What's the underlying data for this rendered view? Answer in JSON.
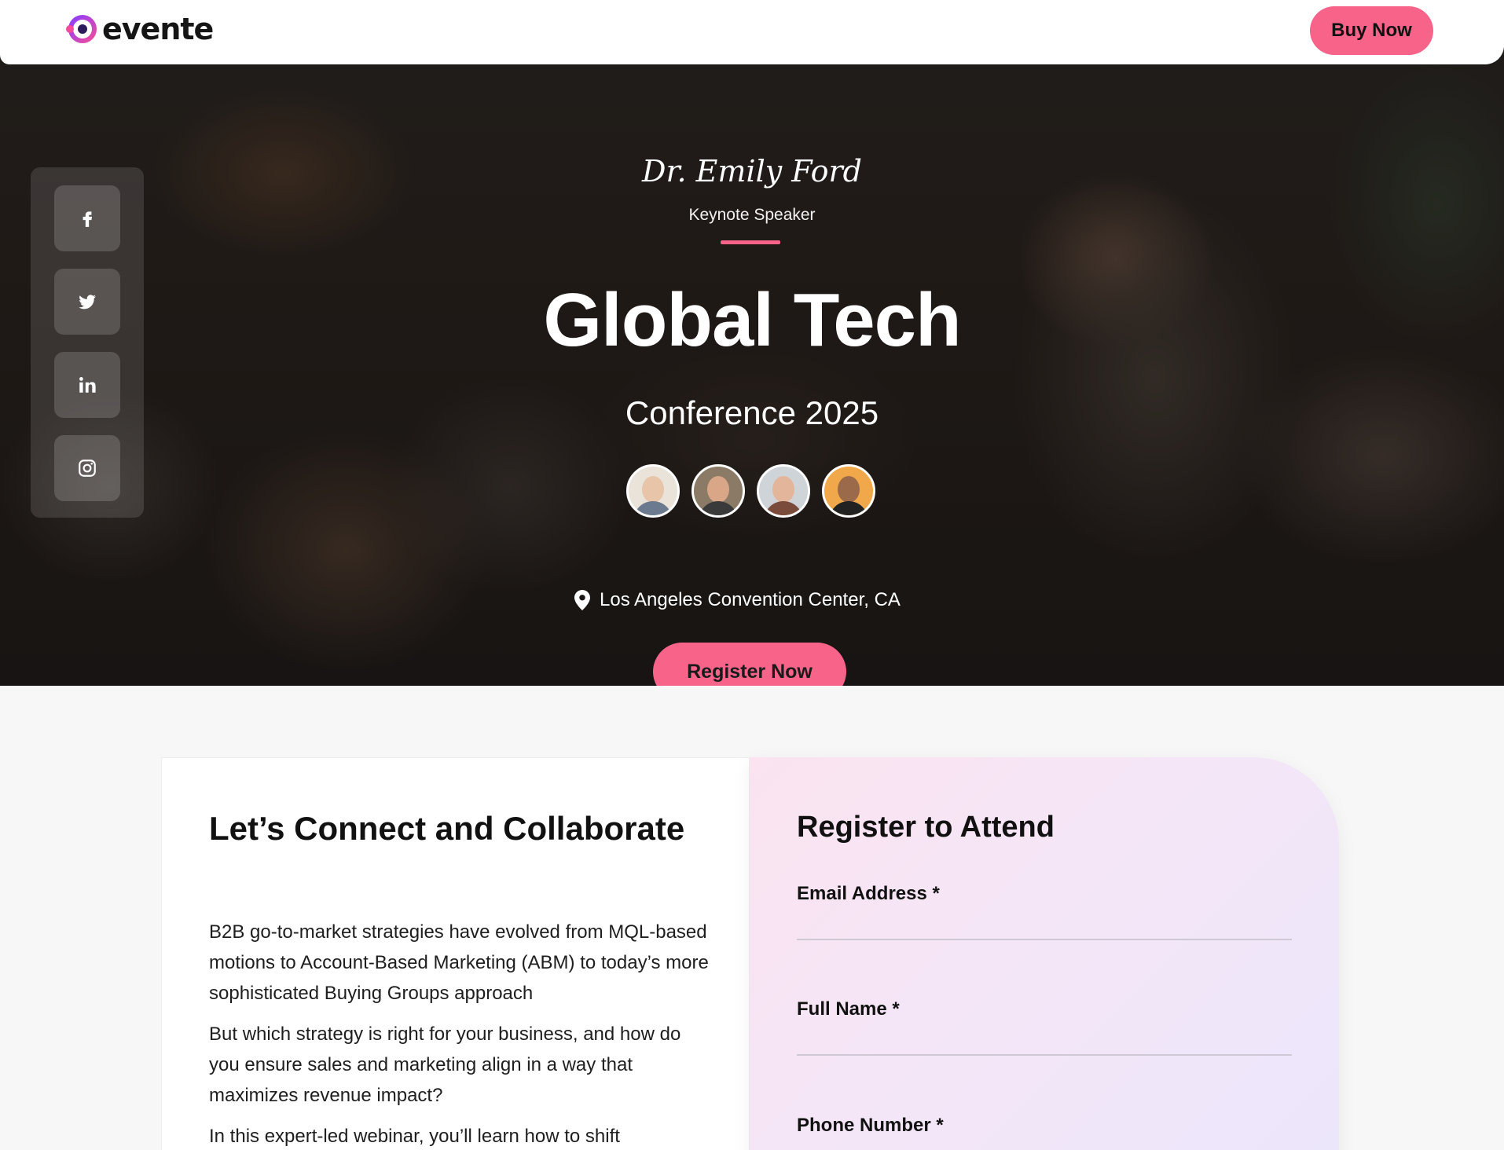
{
  "header": {
    "logo_text": "evente",
    "buy_label": "Buy Now"
  },
  "hero": {
    "speaker_name": "Dr. Emily Ford",
    "speaker_role": "Keynote Speaker",
    "title": "Global Tech",
    "subtitle": "Conference 2025",
    "location": "Los Angeles Convention Center, CA",
    "register_label": "Register Now",
    "social": [
      "facebook-icon",
      "twitter-icon",
      "linkedin-icon",
      "instagram-icon"
    ],
    "accent_color": "#f76389"
  },
  "about": {
    "heading": "Let’s Connect and Collaborate",
    "paragraphs": [
      "B2B go-to-market strategies have evolved from MQL-based motions to Account-Based Marketing (ABM) to today’s more sophisticated Buying Groups approach",
      "But which strategy is right for your business, and how do you ensure sales and marketing align in a way that maximizes revenue impact?",
      "In this expert-led webinar, you’ll learn how to shift"
    ]
  },
  "form": {
    "heading": "Register to Attend",
    "fields": [
      {
        "label": "Email Address *",
        "value": ""
      },
      {
        "label": "Full Name *",
        "value": ""
      },
      {
        "label": "Phone Number *",
        "value": ""
      }
    ]
  }
}
